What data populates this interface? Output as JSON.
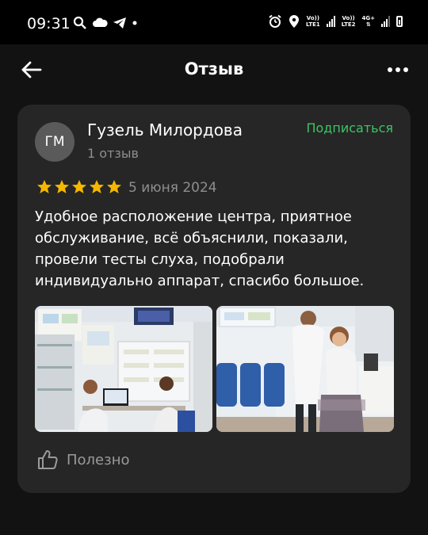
{
  "status_bar": {
    "time": "09:31",
    "net1_top": "Vo))",
    "net1_bottom": "LTE1",
    "net2_top": "Vo))",
    "net2_bottom": "LTE2",
    "net2_type": "4G+"
  },
  "header": {
    "title": "Отзыв",
    "back_icon": "arrow-left-icon",
    "more_icon": "more-horizontal-icon"
  },
  "review": {
    "author_initials": "ГМ",
    "author_name": "Гузель Милордова",
    "author_reviews_count": "1 отзыв",
    "subscribe_label": "Подписаться",
    "rating": 5,
    "rating_max": 5,
    "date": "5 июня 2024",
    "text": "Удобное расположение центра, приятное обслуживание, всё объяснили, показали, провели тесты слуха, подобрали индивидуально аппарат, спасибо большое.",
    "useful_label": "Полезно"
  },
  "colors": {
    "background": "#121212",
    "card": "#262626",
    "accent_green": "#3cc564",
    "star": "#f5b800",
    "muted": "#8e8e8e"
  }
}
